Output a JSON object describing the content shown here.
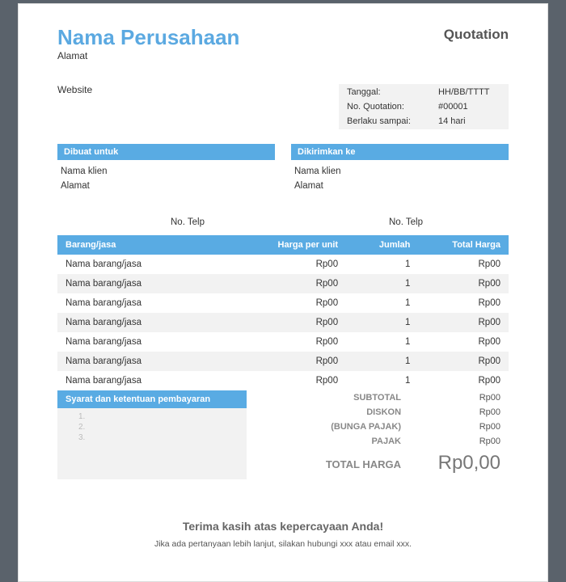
{
  "company": {
    "name": "Nama Perusahaan",
    "address": "Alamat",
    "website": "Website"
  },
  "doc": {
    "title": "Quotation"
  },
  "meta": {
    "date_label": "Tanggal:",
    "date_value": "HH/BB/TTTT",
    "no_label": "No. Quotation:",
    "no_value": "#00001",
    "valid_label": "Berlaku sampai:",
    "valid_value": "14 hari"
  },
  "billto": {
    "title": "Dibuat untuk",
    "name": "Nama klien",
    "address": "Alamat",
    "phone": "No. Telp"
  },
  "shipto": {
    "title": "Dikirimkan ke",
    "name": "Nama klien",
    "address": "Alamat",
    "phone": "No. Telp"
  },
  "columns": {
    "item": "Barang/jasa",
    "unit": "Harga per unit",
    "qty": "Jumlah",
    "total": "Total Harga"
  },
  "rows": [
    {
      "name": "Nama barang/jasa",
      "unit": "Rp00",
      "qty": "1",
      "total": "Rp00"
    },
    {
      "name": "Nama barang/jasa",
      "unit": "Rp00",
      "qty": "1",
      "total": "Rp00"
    },
    {
      "name": "Nama barang/jasa",
      "unit": "Rp00",
      "qty": "1",
      "total": "Rp00"
    },
    {
      "name": "Nama barang/jasa",
      "unit": "Rp00",
      "qty": "1",
      "total": "Rp00"
    },
    {
      "name": "Nama barang/jasa",
      "unit": "Rp00",
      "qty": "1",
      "total": "Rp00"
    },
    {
      "name": "Nama barang/jasa",
      "unit": "Rp00",
      "qty": "1",
      "total": "Rp00"
    },
    {
      "name": "Nama barang/jasa",
      "unit": "Rp00",
      "qty": "1",
      "total": "Rp00"
    }
  ],
  "terms": {
    "title": "Syarat dan ketentuan pembayaran",
    "items": [
      "1.",
      "2.",
      "3."
    ]
  },
  "totals": {
    "subtotal_label": "SUBTOTAL",
    "subtotal_value": "Rp00",
    "discount_label": "DISKON",
    "discount_value": "Rp00",
    "taxint_label": "(BUNGA PAJAK)",
    "taxint_value": "Rp00",
    "tax_label": "PAJAK",
    "tax_value": "Rp00",
    "grand_label": "TOTAL HARGA",
    "grand_value": "Rp0,00"
  },
  "footer": {
    "thanks": "Terima kasih atas kepercayaan Anda!",
    "contact": "Jika ada pertanyaan lebih lanjut, silakan hubungi xxx atau email xxx."
  }
}
